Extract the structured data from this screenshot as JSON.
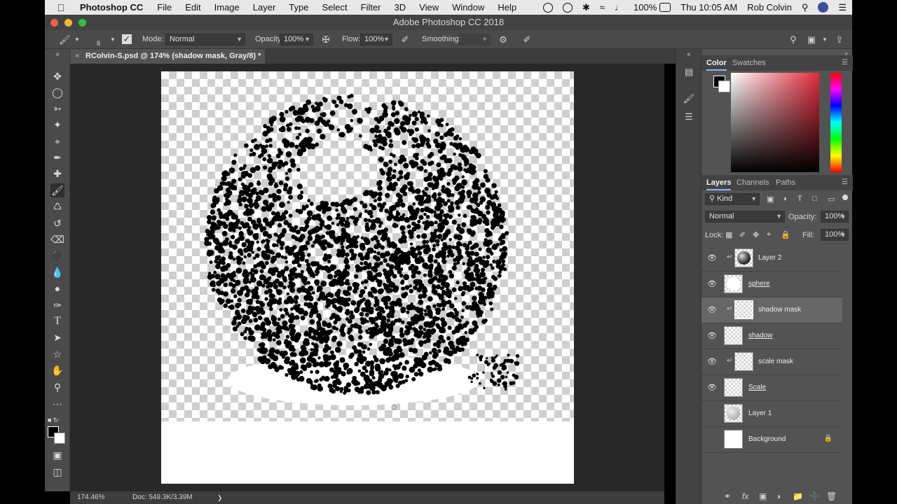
{
  "menubar": {
    "app_name": "Photoshop CC",
    "items": [
      "File",
      "Edit",
      "Image",
      "Layer",
      "Type",
      "Select",
      "Filter",
      "3D",
      "View",
      "Window",
      "Help"
    ],
    "battery": "100%",
    "datetime": "Thu 10:05 AM",
    "user": "Rob Colvin"
  },
  "window": {
    "title": "Adobe Photoshop CC 2018",
    "traffic_colors": [
      "#ee5c52",
      "#f1b531",
      "#2fc03f"
    ]
  },
  "options": {
    "brush_size": "8",
    "mode_label": "Mode:",
    "mode_value": "Normal",
    "opacity_label": "Opacity:",
    "opacity_value": "100%",
    "flow_label": "Flow:",
    "flow_value": "100%",
    "smoothing_label": "Smoothing:",
    "smoothing_value": ""
  },
  "document": {
    "tab_title": "RColvin-S.psd @ 174% (shadow mask, Gray/8) *"
  },
  "status": {
    "zoom": "174.46%",
    "doc_size": "Doc: 549.3K/3.39M",
    "arrow": "❯"
  },
  "tools": [
    "move-tool",
    "marquee-tool",
    "lasso-tool",
    "quick-select-tool",
    "crop-tool",
    "eyedropper-tool",
    "healing-brush-tool",
    "brush-tool",
    "stamp-tool",
    "history-brush-tool",
    "eraser-tool",
    "paint-bucket-tool",
    "blur-tool",
    "dodge-tool",
    "pen-tool",
    "type-tool",
    "path-select-tool",
    "shape-tool",
    "hand-tool",
    "zoom-tool",
    "more-tools"
  ],
  "color_panel": {
    "tabs": [
      "Color",
      "Swatches"
    ],
    "foreground": "#000000",
    "background": "#ffffff"
  },
  "layers_panel": {
    "tabs": [
      "Layers",
      "Channels",
      "Paths"
    ],
    "filter_label": "Kind",
    "blend_mode": "Normal",
    "opacity_label": "Opacity:",
    "opacity_value": "100%",
    "lock_label": "Lock:",
    "fill_label": "Fill:",
    "fill_value": "100%",
    "layers": [
      {
        "name": "Layer 2",
        "visible": true,
        "clipped": true,
        "selected": false,
        "linked_name": false
      },
      {
        "name": "sphere",
        "visible": true,
        "clipped": false,
        "selected": false,
        "linked_name": true
      },
      {
        "name": "shadow mask",
        "visible": true,
        "clipped": true,
        "selected": true,
        "linked_name": false
      },
      {
        "name": "shadow",
        "visible": true,
        "clipped": false,
        "selected": false,
        "linked_name": true
      },
      {
        "name": "scale mask",
        "visible": true,
        "clipped": true,
        "selected": false,
        "linked_name": false
      },
      {
        "name": "Scale",
        "visible": true,
        "clipped": false,
        "selected": false,
        "linked_name": true
      },
      {
        "name": "Layer 1",
        "visible": false,
        "clipped": false,
        "selected": false,
        "linked_name": false
      },
      {
        "name": "Background",
        "visible": false,
        "clipped": false,
        "selected": false,
        "linked_name": false,
        "locked": true
      }
    ]
  }
}
